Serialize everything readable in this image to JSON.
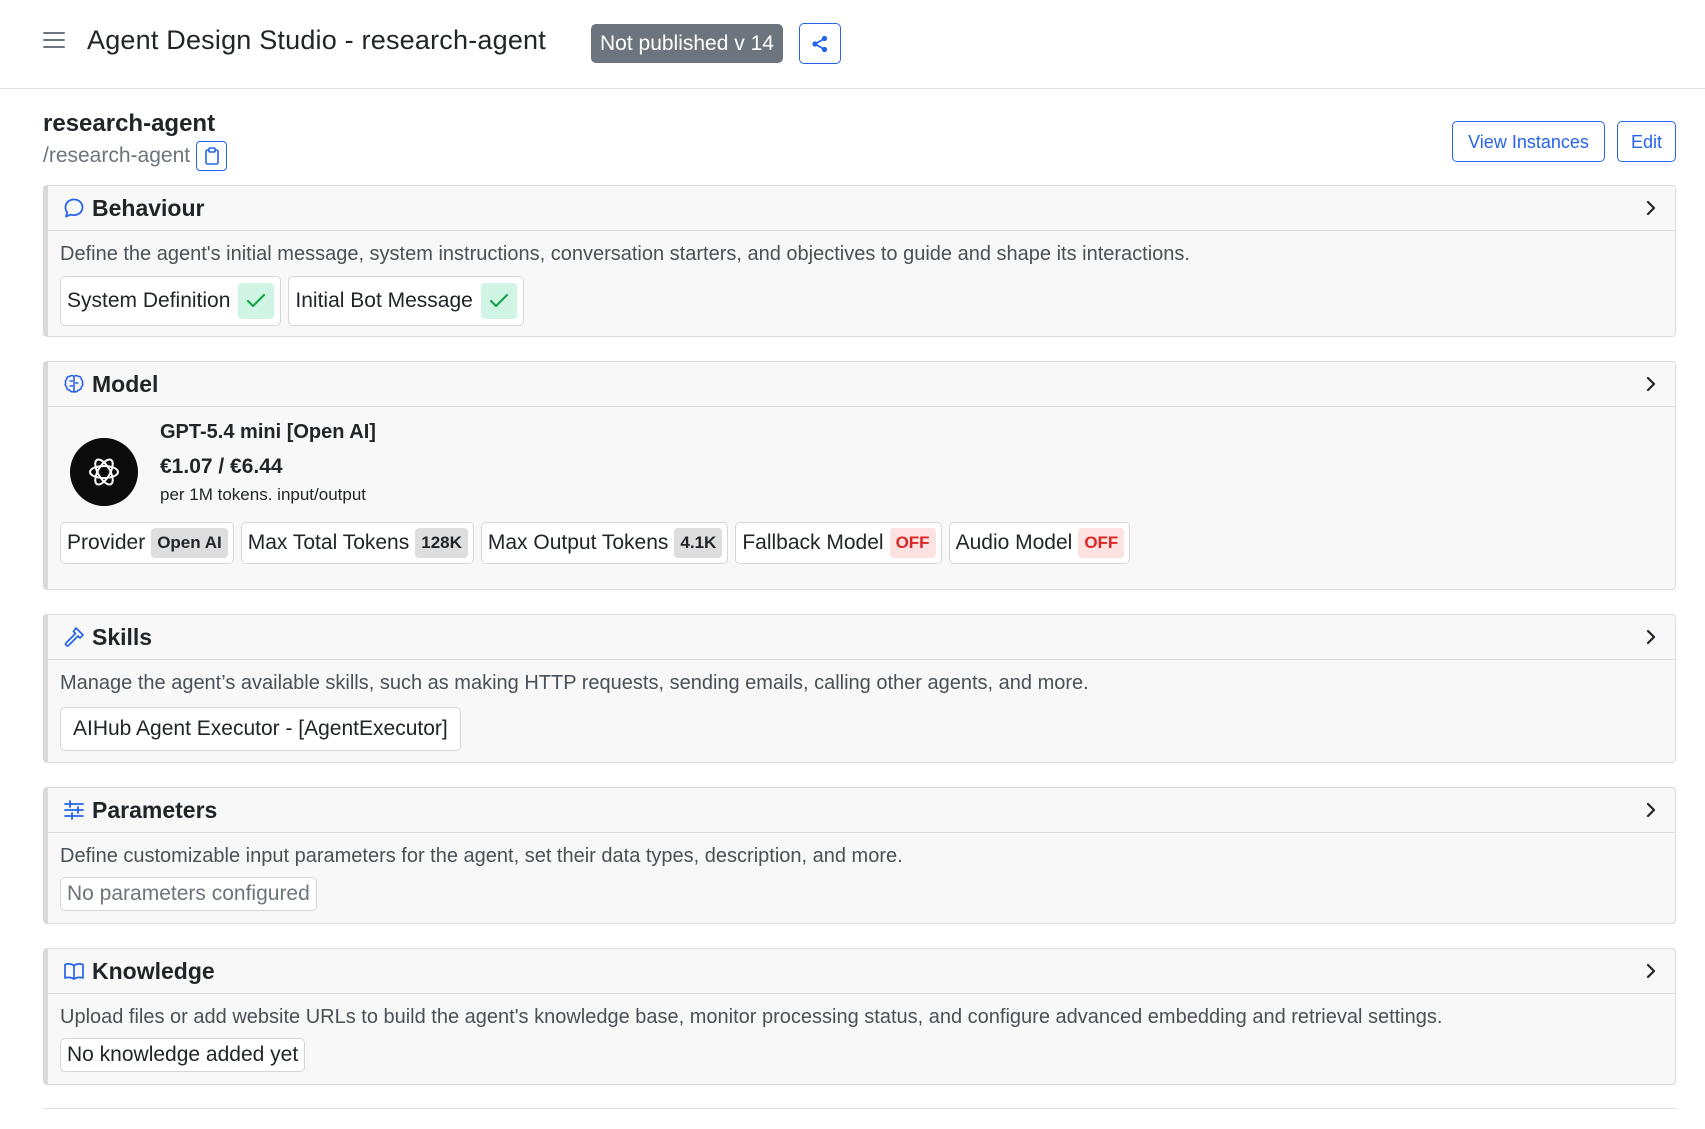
{
  "header": {
    "title": "Agent Design Studio - research-agent",
    "publish_status": "Not published v 14",
    "menu_icon": "hamburger-icon",
    "share_icon": "share-icon"
  },
  "agent": {
    "name": "research-agent",
    "path": "/research-agent",
    "copy_icon": "clipboard-icon",
    "view_instances_label": "View Instances",
    "edit_label": "Edit"
  },
  "sections": {
    "behaviour": {
      "title": "Behaviour",
      "icon": "chat-bubble-icon",
      "description": "Define the agent's initial message, system instructions, conversation starters, and objectives to guide and shape its interactions.",
      "chips": [
        "System Definition",
        "Initial Bot Message"
      ]
    },
    "model": {
      "title": "Model",
      "icon": "brain-icon",
      "name": "GPT-5.4 mini [Open AI]",
      "price": "€1.07 / €6.44",
      "unit": "per 1M tokens. input/output",
      "logo_icon": "openai-logo-icon",
      "chips": [
        {
          "label": "Provider",
          "value": "Open AI",
          "kind": "gray"
        },
        {
          "label": "Max Total Tokens",
          "value": "128K",
          "kind": "gray"
        },
        {
          "label": "Max Output Tokens",
          "value": "4.1K",
          "kind": "gray"
        },
        {
          "label": "Fallback Model",
          "value": "OFF",
          "kind": "off"
        },
        {
          "label": "Audio Model",
          "value": "OFF",
          "kind": "off"
        }
      ]
    },
    "skills": {
      "title": "Skills",
      "icon": "hammer-icon",
      "description": "Manage the agent’s available skills, such as making HTTP requests, sending emails, calling other agents, and more.",
      "items": [
        "AIHub Agent Executor - [AgentExecutor]"
      ]
    },
    "parameters": {
      "title": "Parameters",
      "icon": "sliders-icon",
      "description": "Define customizable input parameters for the agent, set their data types, description, and more.",
      "empty": "No parameters configured"
    },
    "knowledge": {
      "title": "Knowledge",
      "icon": "book-icon",
      "description": "Upload files or add website URLs to build the agent's knowledge base, monitor processing status, and configure advanced embedding and retrieval settings.",
      "empty": "No knowledge added yet"
    }
  },
  "colors": {
    "accent": "#2563eb",
    "badge_bg": "#6c757d",
    "success_bg": "#d1f5e4",
    "success": "#16a34a",
    "off_bg": "#fde2e2",
    "off_text": "#dc2626"
  }
}
